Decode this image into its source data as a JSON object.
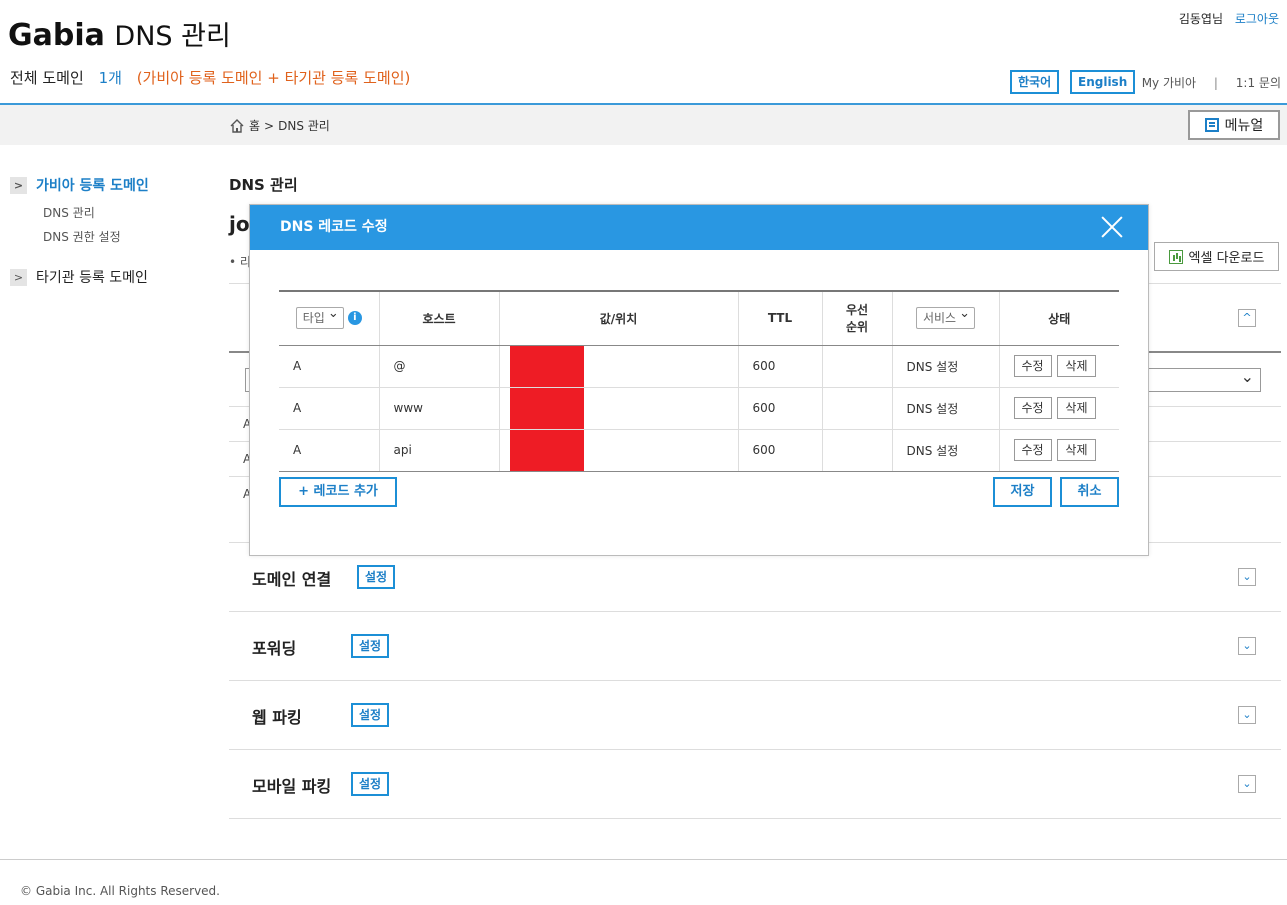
{
  "header": {
    "brand_name": "Gabia",
    "brand_suffix": "DNS 관리",
    "user_name": "김동엽님",
    "logout": "로그아웃",
    "subtitle_all": "전체 도메인",
    "subtitle_count": "1개",
    "subtitle_note": "(가비아 등록 도메인 + 타기관 등록 도메인)",
    "lang_ko": "한국어",
    "lang_en": "English",
    "my_gabia": "My 가비아",
    "separator": "|",
    "inquiry": "1:1 문의"
  },
  "breadcrumb": {
    "home": "홈",
    "sep": ">",
    "current": "DNS 관리",
    "manual": "메뉴얼"
  },
  "sidebar": {
    "sections": [
      {
        "label": "가비아 등록 도메인",
        "items": [
          "DNS 관리",
          "DNS 권한 설정"
        ]
      },
      {
        "label": "타기관 등록 도메인",
        "items": []
      }
    ]
  },
  "main": {
    "title": "DNS 관리",
    "domain_partial": "jo",
    "tab_partial": "리",
    "excel_download": "엑셀 다운로드",
    "bg_rows": [
      "A",
      "A",
      "A"
    ],
    "sections": [
      {
        "title": "도메인 연결",
        "button": "설정"
      },
      {
        "title": "포워딩",
        "button": "설정"
      },
      {
        "title": "웹 파킹",
        "button": "설정"
      },
      {
        "title": "모바일 파킹",
        "button": "설정"
      }
    ]
  },
  "modal": {
    "title": "DNS 레코드 수정",
    "columns": {
      "type": "타입",
      "info": "i",
      "host": "호스트",
      "value": "값/위치",
      "ttl": "TTL",
      "priority_1": "우선",
      "priority_2": "순위",
      "service": "서비스",
      "status": "상태"
    },
    "rows": [
      {
        "type": "A",
        "host": "@",
        "ttl": "600",
        "service": "DNS 설정",
        "edit": "수정",
        "delete": "삭제"
      },
      {
        "type": "A",
        "host": "www",
        "ttl": "600",
        "service": "DNS 설정",
        "edit": "수정",
        "delete": "삭제"
      },
      {
        "type": "A",
        "host": "api",
        "ttl": "600",
        "service": "DNS 설정",
        "edit": "수정",
        "delete": "삭제"
      }
    ],
    "add_record": "+ 레코드 추가",
    "save": "저장",
    "cancel": "취소"
  },
  "footer": {
    "copyright": "© Gabia Inc. All Rights Reserved."
  },
  "colors": {
    "brand_blue": "#2997e2",
    "link_blue": "#1c7fc7",
    "note_orange": "#e0621c",
    "redaction": "#ee1c25"
  }
}
